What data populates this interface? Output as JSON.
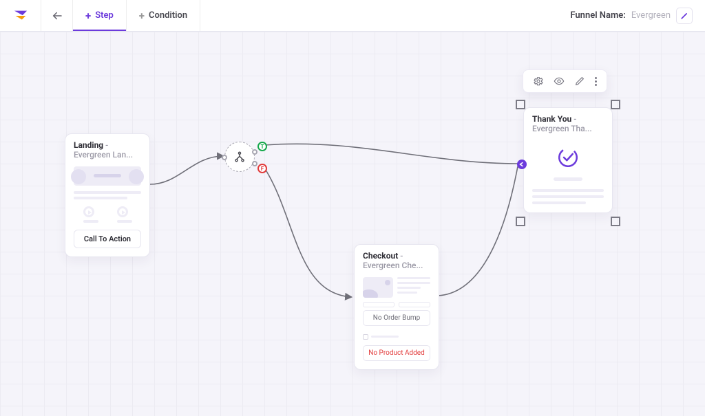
{
  "toolbar": {
    "step_label": "Step",
    "condition_label": "Condition",
    "funnel_name_label": "Funnel Name:",
    "funnel_name_value": "Evergreen"
  },
  "nodes": {
    "landing": {
      "title": "Landing",
      "subtitle": " - Evergreen Lan...",
      "cta": "Call To Action"
    },
    "checkout": {
      "title": "Checkout",
      "subtitle": " - Evergreen Che...",
      "order_bump": "No Order Bump",
      "product": "No Product Added"
    },
    "thankyou": {
      "title": "Thank You",
      "subtitle": " - Evergreen Tha..."
    },
    "condition": {
      "true_badge": "T",
      "false_badge": "F"
    }
  }
}
